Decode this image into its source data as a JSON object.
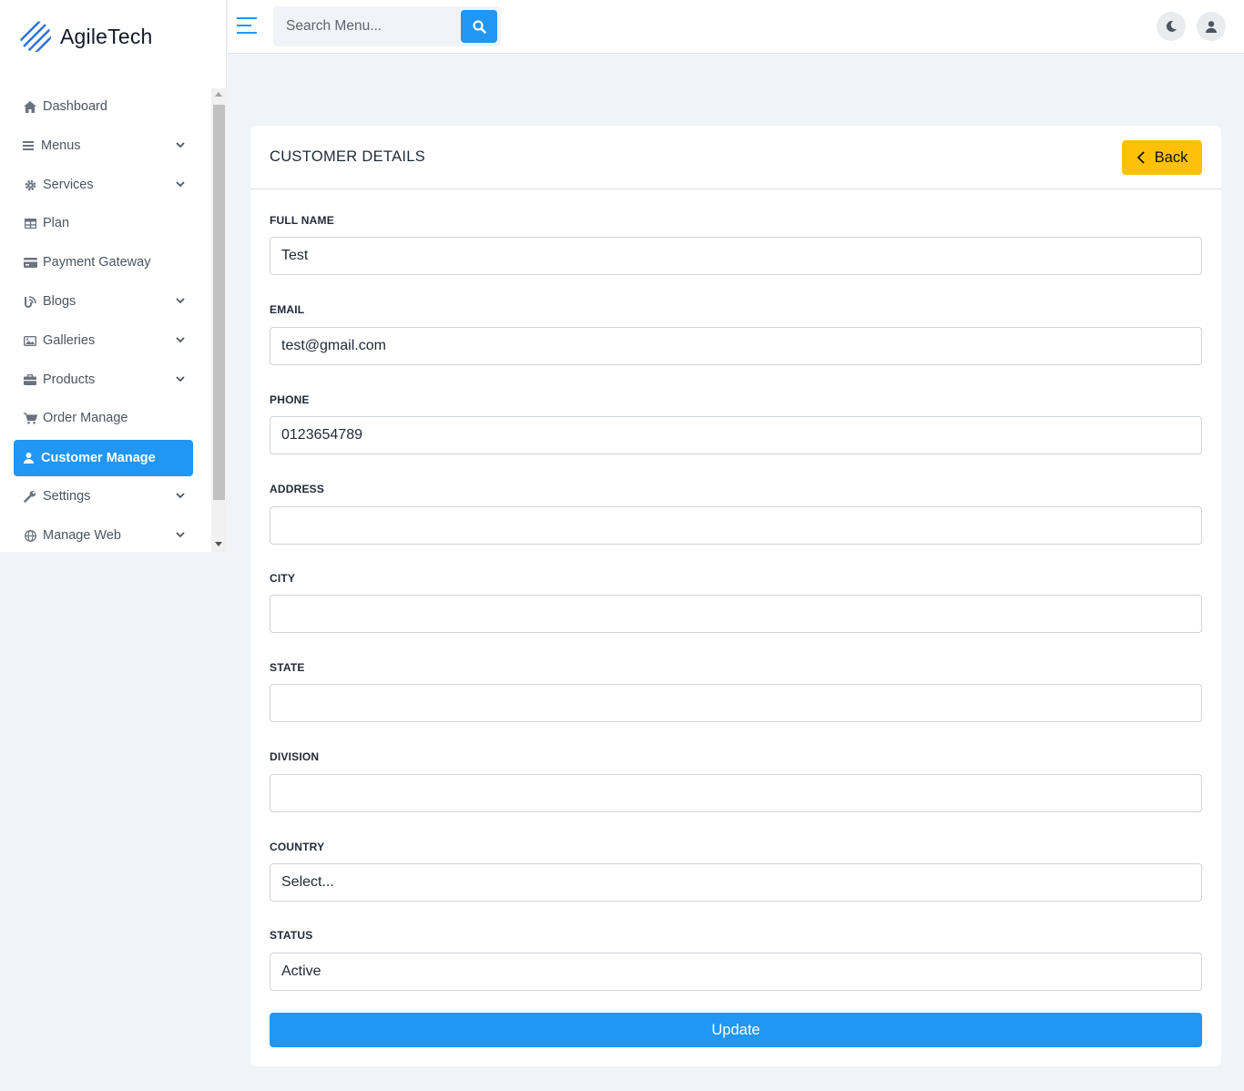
{
  "brand": {
    "name": "AgileTech"
  },
  "search": {
    "placeholder": "Search Menu...",
    "button_icon": "search-icon"
  },
  "topbar": {
    "theme_icon": "moon-icon",
    "user_icon": "user-icon",
    "menu_icon": "hamburger-icon"
  },
  "sidebar": {
    "items": [
      {
        "label": "Dashboard",
        "icon": "home-icon",
        "has_submenu": false,
        "active": false
      },
      {
        "label": "Menus",
        "icon": "list-icon",
        "has_submenu": true,
        "active": false
      },
      {
        "label": "Services",
        "icon": "gear-icon",
        "has_submenu": true,
        "active": false
      },
      {
        "label": "Plan",
        "icon": "table-icon",
        "has_submenu": false,
        "active": false
      },
      {
        "label": "Payment Gateway",
        "icon": "credit-card-icon",
        "has_submenu": false,
        "active": false
      },
      {
        "label": "Blogs",
        "icon": "blog-icon",
        "has_submenu": true,
        "active": false
      },
      {
        "label": "Galleries",
        "icon": "image-icon",
        "has_submenu": true,
        "active": false
      },
      {
        "label": "Products",
        "icon": "briefcase-icon",
        "has_submenu": true,
        "active": false
      },
      {
        "label": "Order Manage",
        "icon": "cart-icon",
        "has_submenu": false,
        "active": false
      },
      {
        "label": "Customer Manage",
        "icon": "user-icon",
        "has_submenu": false,
        "active": true
      },
      {
        "label": "Settings",
        "icon": "wrench-icon",
        "has_submenu": true,
        "active": false
      },
      {
        "label": "Manage Web",
        "icon": "globe-icon",
        "has_submenu": true,
        "active": false
      }
    ]
  },
  "card": {
    "title": "CUSTOMER DETAILS",
    "back_label": "Back",
    "fields": {
      "full_name": {
        "label": "FULL NAME",
        "value": "Test"
      },
      "email": {
        "label": "EMAIL",
        "value": "test@gmail.com"
      },
      "phone": {
        "label": "PHONE",
        "value": "0123654789"
      },
      "address": {
        "label": "ADDRESS",
        "value": ""
      },
      "city": {
        "label": "CITY",
        "value": ""
      },
      "state": {
        "label": "STATE",
        "value": ""
      },
      "division": {
        "label": "DIVISION",
        "value": ""
      },
      "country": {
        "label": "COUNTRY",
        "selected": "Select..."
      },
      "status": {
        "label": "STATUS",
        "selected": "Active"
      }
    },
    "update_label": "Update"
  },
  "colors": {
    "primary": "#2196f3",
    "warning": "#ffc107",
    "background": "#f0f3f8"
  }
}
